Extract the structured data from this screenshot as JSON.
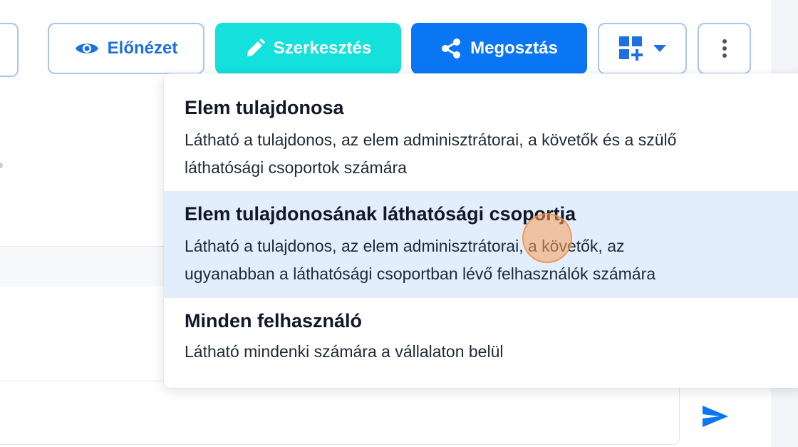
{
  "toolbar": {
    "preview_label": "Előnézet",
    "edit_label": "Szerkesztés",
    "share_label": "Megosztás"
  },
  "colors": {
    "primary": "#0b76f4",
    "accent_teal": "#14e0dc",
    "outline_border": "#a9c5ee",
    "selected_bg": "#e3eefc"
  },
  "icons": {
    "preview": "eye-icon",
    "edit": "pencil-icon",
    "share": "share-icon",
    "add_widget": "grid-add-icon",
    "dropdown": "caret-down-icon",
    "more": "more-vertical-icon",
    "send": "send-icon"
  },
  "visibility_menu": {
    "options": [
      {
        "title": "Elem tulajdonosa",
        "desc_line1": "Látható a tulajdonos, az elem adminisztrátorai, a követők és a szülő",
        "desc_line2": "láthatósági csoportok számára",
        "selected": false
      },
      {
        "title": "Elem tulajdonosának láthatósági csoportja",
        "desc_line1": "Látható a tulajdonos, az elem adminisztrátorai, a követők, az",
        "desc_line2": "ugyanabban a láthatósági csoportban lévő felhasználók számára",
        "selected": true
      },
      {
        "title": "Minden felhasználó",
        "desc_line1": "Látható mindenki számára a vállalaton belül",
        "selected": false
      }
    ]
  }
}
